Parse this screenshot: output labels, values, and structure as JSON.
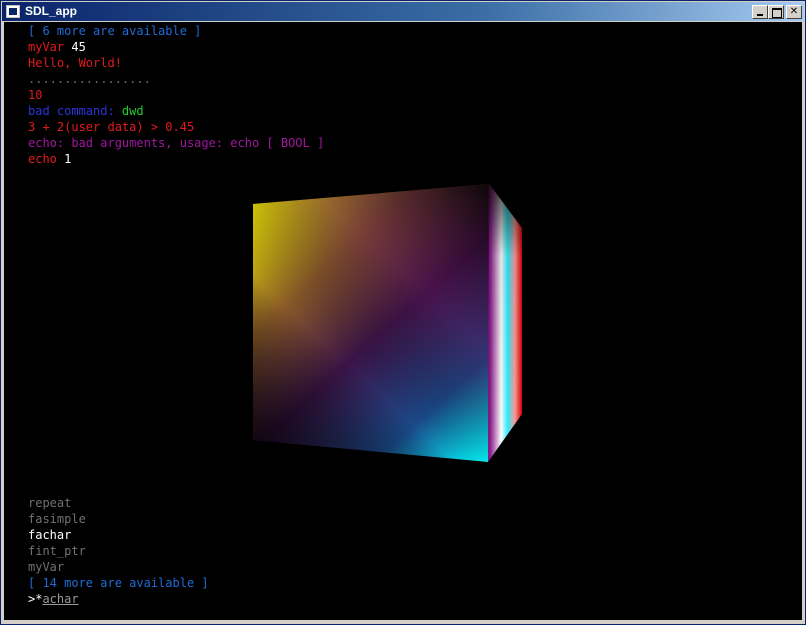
{
  "window": {
    "title": "SDL_app"
  },
  "console_top": [
    {
      "parts": [
        {
          "text": "[ 6 more are available ]",
          "color": "#1f6bd6"
        }
      ]
    },
    {
      "parts": [
        {
          "text": "myVar ",
          "color": "#e11b1b"
        },
        {
          "text": "45",
          "color": "#ffffff"
        }
      ]
    },
    {
      "parts": [
        {
          "text": "Hello, World!",
          "color": "#e11b1b"
        }
      ]
    },
    {
      "parts": [
        {
          "text": ".................",
          "color": "#6a6a6a"
        }
      ]
    },
    {
      "parts": [
        {
          "text": "10",
          "color": "#e11b1b"
        }
      ]
    },
    {
      "parts": [
        {
          "text": "bad command: ",
          "color": "#2a35d8"
        },
        {
          "text": "dwd",
          "color": "#1fd02b"
        }
      ]
    },
    {
      "parts": [
        {
          "text": "3 + 2(user data) > 0.45",
          "color": "#e11b1b"
        }
      ]
    },
    {
      "parts": [
        {
          "text": "echo: bad arguments, usage: echo [ BOOL ]",
          "color": "#a0179c"
        }
      ]
    },
    {
      "parts": [
        {
          "text": "echo ",
          "color": "#e11b1b"
        },
        {
          "text": "1",
          "color": "#ffffff"
        }
      ]
    }
  ],
  "suggestions": [
    {
      "text": "repeat",
      "color": "#707070"
    },
    {
      "text": "fasimple",
      "color": "#707070"
    },
    {
      "text": "fachar",
      "color": "#ffffff"
    },
    {
      "text": "fint_ptr",
      "color": "#707070"
    },
    {
      "text": "myVar",
      "color": "#707070"
    }
  ],
  "more_available": {
    "text": "[ 14 more are available ]",
    "color": "#1f6bd6"
  },
  "prompt": {
    "symbol": ">*",
    "input": "achar"
  },
  "cube_colors": [
    "#ffff00",
    "#ff0000",
    "#00ffff",
    "#000000",
    "#ff00ff",
    "#ffffff"
  ]
}
